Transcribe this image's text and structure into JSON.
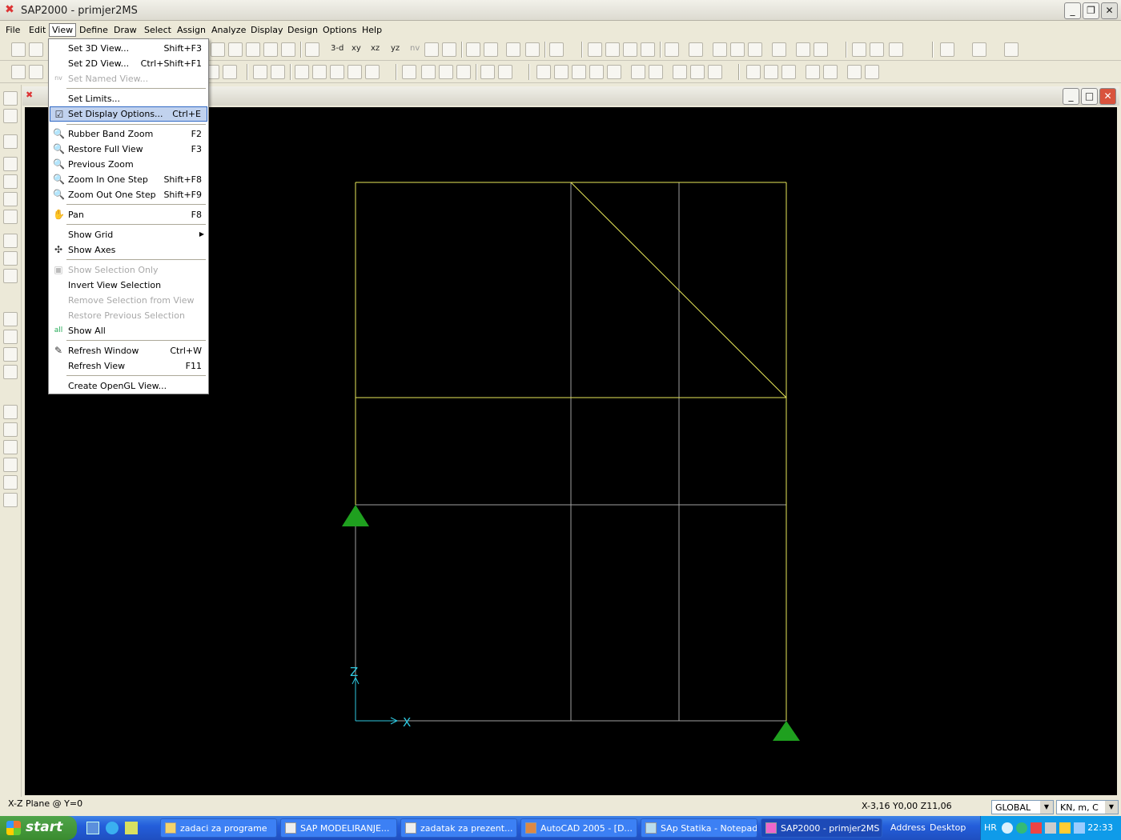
{
  "window": {
    "title": "SAP2000 - primjer2MS",
    "app_icon": "sap-logo-icon"
  },
  "menubar": [
    "File",
    "Edit",
    "View",
    "Define",
    "Draw",
    "Select",
    "Assign",
    "Analyze",
    "Display",
    "Design",
    "Options",
    "Help"
  ],
  "toolbar": {
    "view_buttons": [
      "3-d",
      "xy",
      "xz",
      "yz",
      "nv"
    ]
  },
  "view_menu": [
    {
      "label": "Set 3D View...",
      "shortcut": "Shift+F3",
      "icon": "",
      "disabled": false
    },
    {
      "label": "Set 2D View...",
      "shortcut": "Ctrl+Shift+F1",
      "icon": "",
      "disabled": false
    },
    {
      "label": "Set Named View...",
      "shortcut": "",
      "icon": "nv",
      "disabled": true
    },
    {
      "sep": true
    },
    {
      "label": "Set Limits...",
      "shortcut": "",
      "icon": "",
      "disabled": false
    },
    {
      "label": "Set Display Options...",
      "shortcut": "Ctrl+E",
      "icon": "checkbox-icon",
      "disabled": false,
      "highlight": true
    },
    {
      "sep": true
    },
    {
      "label": "Rubber Band Zoom",
      "shortcut": "F2",
      "icon": "zoom-icon",
      "disabled": false
    },
    {
      "label": "Restore Full View",
      "shortcut": "F3",
      "icon": "zoom-full-icon",
      "disabled": false
    },
    {
      "label": "Previous Zoom",
      "shortcut": "",
      "icon": "zoom-prev-icon",
      "disabled": false
    },
    {
      "label": "Zoom In One Step",
      "shortcut": "Shift+F8",
      "icon": "zoom-in-icon",
      "disabled": false
    },
    {
      "label": "Zoom Out One Step",
      "shortcut": "Shift+F9",
      "icon": "zoom-out-icon",
      "disabled": false
    },
    {
      "sep": true
    },
    {
      "label": "Pan",
      "shortcut": "F8",
      "icon": "pan-icon",
      "disabled": false
    },
    {
      "sep": true
    },
    {
      "label": "Show Grid",
      "shortcut": "",
      "icon": "",
      "disabled": false,
      "submenu": true
    },
    {
      "label": "Show Axes",
      "shortcut": "",
      "icon": "axes-icon",
      "disabled": false
    },
    {
      "sep": true
    },
    {
      "label": "Show Selection Only",
      "shortcut": "",
      "icon": "selection-icon",
      "disabled": true
    },
    {
      "label": "Invert View Selection",
      "shortcut": "",
      "icon": "",
      "disabled": false
    },
    {
      "label": "Remove Selection from View",
      "shortcut": "",
      "icon": "",
      "disabled": true
    },
    {
      "label": "Restore Previous Selection",
      "shortcut": "",
      "icon": "",
      "disabled": true
    },
    {
      "label": "Show  All",
      "shortcut": "",
      "icon": "show-all-icon",
      "disabled": false
    },
    {
      "sep": true
    },
    {
      "label": "Refresh Window",
      "shortcut": "Ctrl+W",
      "icon": "pencil-icon",
      "disabled": false
    },
    {
      "label": "Refresh View",
      "shortcut": "F11",
      "icon": "",
      "disabled": false
    },
    {
      "sep": true
    },
    {
      "label": "Create OpenGL View...",
      "shortcut": "",
      "icon": "",
      "disabled": false
    }
  ],
  "canvas": {
    "axis_x_label": "X",
    "axis_z_label": "Z",
    "frame_color": "#e8e85a",
    "grid_color": "#a0a0a0",
    "support_color": "#1fa01f",
    "axis_color": "#2fc8e0"
  },
  "status": {
    "plane": "X-Z Plane @ Y=0",
    "coords": "X-3,16  Y0,00  Z11,06",
    "coord_system": "GLOBAL",
    "units": "KN, m, C"
  },
  "taskbar": {
    "start_label": "start",
    "tasks": [
      "zadaci za programe",
      "SAP  MODELIRANJE...",
      "zadatak za prezent...",
      "AutoCAD 2005 - [D...",
      "SAp Statika - Notepad",
      "SAP2000 - primjer2MS"
    ],
    "address_label": "Address",
    "desktop_label": "Desktop",
    "lang": "HR",
    "clock": "22:33"
  }
}
